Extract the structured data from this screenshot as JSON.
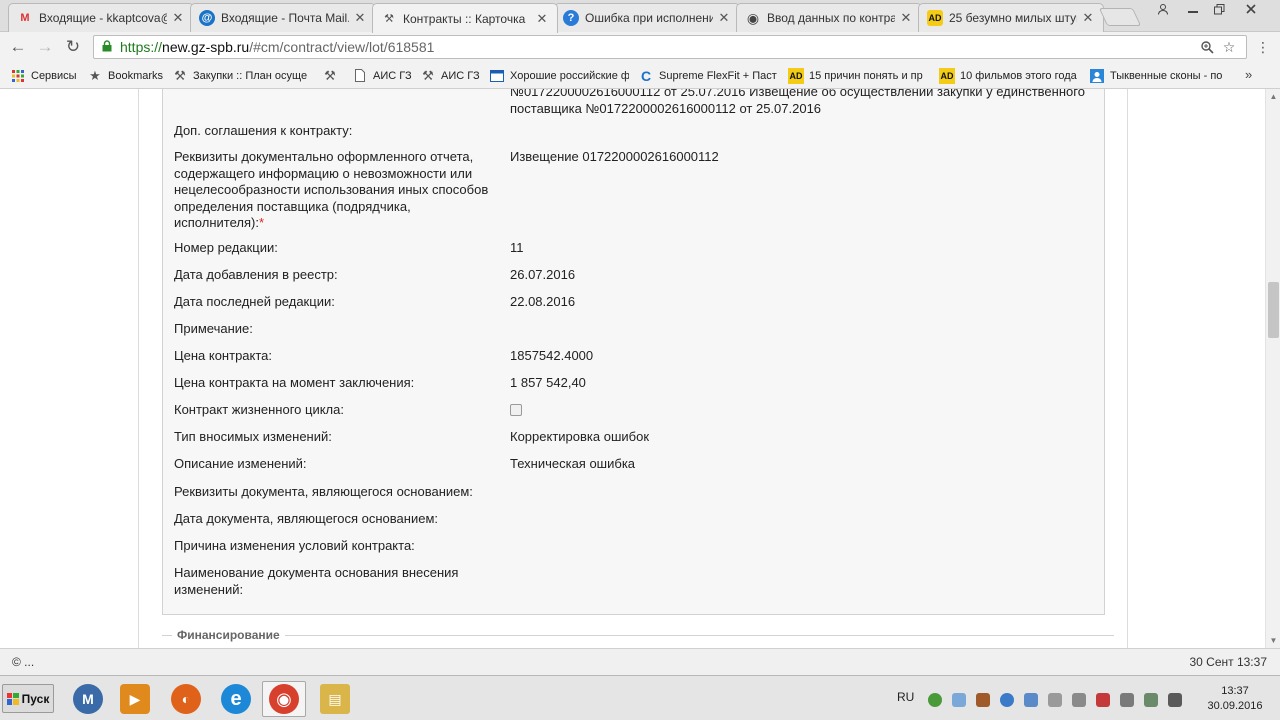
{
  "tabs": [
    {
      "title": "Входящие - kkaptcova@",
      "icon": "gmail-icon",
      "glyph": "M",
      "color": "#d33",
      "active": false
    },
    {
      "title": "Входящие - Почта Mail.",
      "icon": "mailru-icon",
      "glyph": "@",
      "color": "#1a73c8",
      "active": false
    },
    {
      "title": "Контракты :: Карточка",
      "icon": "hammer-icon",
      "glyph": "⚒",
      "color": "#555",
      "active": true
    },
    {
      "title": "Ошибка при исполнени",
      "icon": "help-icon",
      "glyph": "?",
      "color": "#2a7bd8",
      "active": false
    },
    {
      "title": "Ввод данных по контра",
      "icon": "chrome-icon",
      "glyph": "◉",
      "color": "#444",
      "active": false
    },
    {
      "title": "25 безумно милых штук",
      "icon": "ad-icon",
      "glyph": "AD",
      "color": "#f4cc16",
      "active": false
    }
  ],
  "address": {
    "scheme": "https://",
    "host": "new.gz-spb.ru",
    "path": "/#cm/contract/view/lot/618581"
  },
  "bookmarks": [
    {
      "label": "Сервисы",
      "icon": "apps-grid-icon"
    },
    {
      "label": "Bookmarks",
      "icon": "star-icon"
    },
    {
      "label": "Закупки :: План осуще",
      "icon": "hammer-icon"
    },
    {
      "label": "",
      "icon": "hammer-icon"
    },
    {
      "label": "АИС ГЗ",
      "icon": "page-icon"
    },
    {
      "label": "АИС ГЗ",
      "icon": "hammer-icon"
    },
    {
      "label": "Хорошие российские ф",
      "icon": "film-icon"
    },
    {
      "label": "Supreme FlexFit + Паст",
      "icon": "spinner-icon"
    },
    {
      "label": "15 причин понять и пр",
      "icon": "ad-icon"
    },
    {
      "label": "10 фильмов этого года",
      "icon": "ad-icon"
    },
    {
      "label": "Тыквенные сконы - по",
      "icon": "avatar-icon"
    }
  ],
  "card": {
    "top_value_overflow": "№0172200002616000112 от 25.07.2016 Извещение об осуществлении закупки у единственного поставщика №0172200002616000112 от 25.07.2016",
    "rows": [
      {
        "label": "Доп. соглашения к контракту:",
        "value": ""
      },
      {
        "label": "Реквизиты документально оформленного отчета, содержащего информацию о невозможности или нецелесообразности использования иных способов определения поставщика (подрядчика, исполнителя):",
        "required_mark": "*",
        "value": "Извещение 0172200002616000112"
      },
      {
        "label": "Номер редакции:",
        "value": "11"
      },
      {
        "label": "Дата добавления в реестр:",
        "value": "26.07.2016"
      },
      {
        "label": "Дата последней редакции:",
        "value": "22.08.2016"
      },
      {
        "label": "Примечание:",
        "value": ""
      },
      {
        "label": "Цена контракта:",
        "value": "1857542.4000"
      },
      {
        "label": "Цена контракта на момент заключения:",
        "value": "1 857 542,40"
      },
      {
        "label": "Контракт жизненного цикла:",
        "value": ""
      },
      {
        "label": "Тип вносимых изменений:",
        "value": "Корректировка ошибок"
      },
      {
        "label": "Описание изменений:",
        "value": "Техническая ошибка"
      },
      {
        "label": "Реквизиты документа, являющегося основанием:",
        "value": ""
      },
      {
        "label": "Дата документа, являющегося основанием:",
        "value": ""
      },
      {
        "label": "Причина изменения условий контракта:",
        "value": ""
      },
      {
        "label": "Наименование документа основания внесения изменений:",
        "value": ""
      }
    ],
    "next_section": "Финансирование"
  },
  "status": {
    "left": "© ...",
    "right": "30 Сент 13:37"
  },
  "taskbar": {
    "start_label": "Пуск",
    "apps": [
      {
        "icon": "manager-app-icon",
        "glyph": "M",
        "color": "#3b6aa8",
        "active": false
      },
      {
        "icon": "media-player-icon",
        "glyph": "▶",
        "color": "#e08a1e",
        "active": false
      },
      {
        "icon": "firefox-icon",
        "glyph": "◐",
        "color": "#e0621a",
        "active": false
      },
      {
        "icon": "ie-icon",
        "glyph": "e",
        "color": "#1e88d8",
        "active": false
      },
      {
        "icon": "chrome-icon",
        "glyph": "◉",
        "color": "#d8402e",
        "active": true
      },
      {
        "icon": "explorer-folder-icon",
        "glyph": "▤",
        "color": "#d9b54a",
        "active": false
      }
    ],
    "lang": "RU",
    "clock_time": "13:37",
    "clock_date": "30.09.2016"
  },
  "colors": {
    "url_host": "#1e7b1e",
    "required": "#dd2222",
    "panel_bg": "#f7f7f7"
  }
}
